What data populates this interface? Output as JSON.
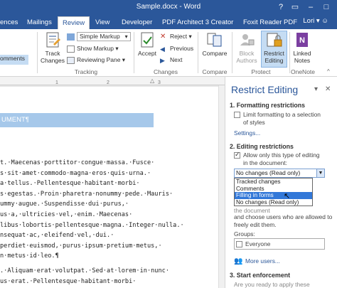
{
  "window": {
    "title": "Sample.docx - Word",
    "user": "Lori"
  },
  "tabs": [
    "ences",
    "Mailings",
    "Review",
    "View",
    "Developer",
    "PDF Architect 3 Creator",
    "Foxit Reader PDF"
  ],
  "ribbon": {
    "comments_partial": "omments",
    "track_changes": "Track Changes",
    "simple_markup": "Simple Markup",
    "show_markup": "Show Markup",
    "reviewing_pane": "Reviewing Pane",
    "tracking_label": "Tracking",
    "accept": "Accept",
    "reject": "Reject",
    "previous": "Previous",
    "next": "Next",
    "changes_label": "Changes",
    "compare": "Compare",
    "compare_label": "Compare",
    "block_authors": "Block Authors",
    "restrict_editing": "Restrict Editing",
    "protect_label": "Protect",
    "linked_notes": "Linked Notes",
    "onenote_label": "OneNote"
  },
  "ruler_ticks": [
    "1",
    "2",
    "3"
  ],
  "document": {
    "heading": "UMENT¶",
    "lines": [
      "t.·Maecenas·porttitor·congue·massa.·Fusce·",
      "s·sit·amet·commodo·magna·eros·quis·urna.·",
      "a·tellus.·Pellentesque·habitant·morbi·",
      "s·egestas.·Proin·pharetra·nonummy·pede.·Mauris·",
      "ummy·augue.·Suspendisse·dui·purus,·",
      "us·a,·ultricies·vel,·enim.·Maecenas·",
      "libus·lobortis·pellentesque·magna.·Integer·nulla.·",
      "nsequat·ac,·eleifend·vel,·dui.·",
      "perdiet·euismod,·purus·ipsum·pretium·metus,·",
      "n·metus·id·leo.¶",
      ".·Aliquam·erat·volutpat.·Sed·at·lorem·in·nunc·",
      "us·erat.·Pellentesque·habitant·morbi·"
    ]
  },
  "pane": {
    "title": "Restrict Editing",
    "s1_head": "1. Formatting restrictions",
    "s1_option_l1": "Limit formatting to a selection",
    "s1_option_l2": "of styles",
    "settings_link": "Settings...",
    "s2_head": "2. Editing restrictions",
    "s2_option_l1": "Allow only this type of editing",
    "s2_option_l2": "in the document:",
    "select_value": "No changes (Read only)",
    "dropdown_options": [
      "Tracked changes",
      "Comments",
      "Filling in forms",
      "No changes (Read only)"
    ],
    "dropdown_highlight_index": 2,
    "partial_line": "the document",
    "exc_l1": "and choose users who are allowed to",
    "exc_l2": "freely edit them.",
    "groups_label": "Groups:",
    "everyone": "Everyone",
    "more_users": "More users...",
    "s3_head": "3. Start enforcement",
    "s3_text": "Are you ready to apply these"
  }
}
